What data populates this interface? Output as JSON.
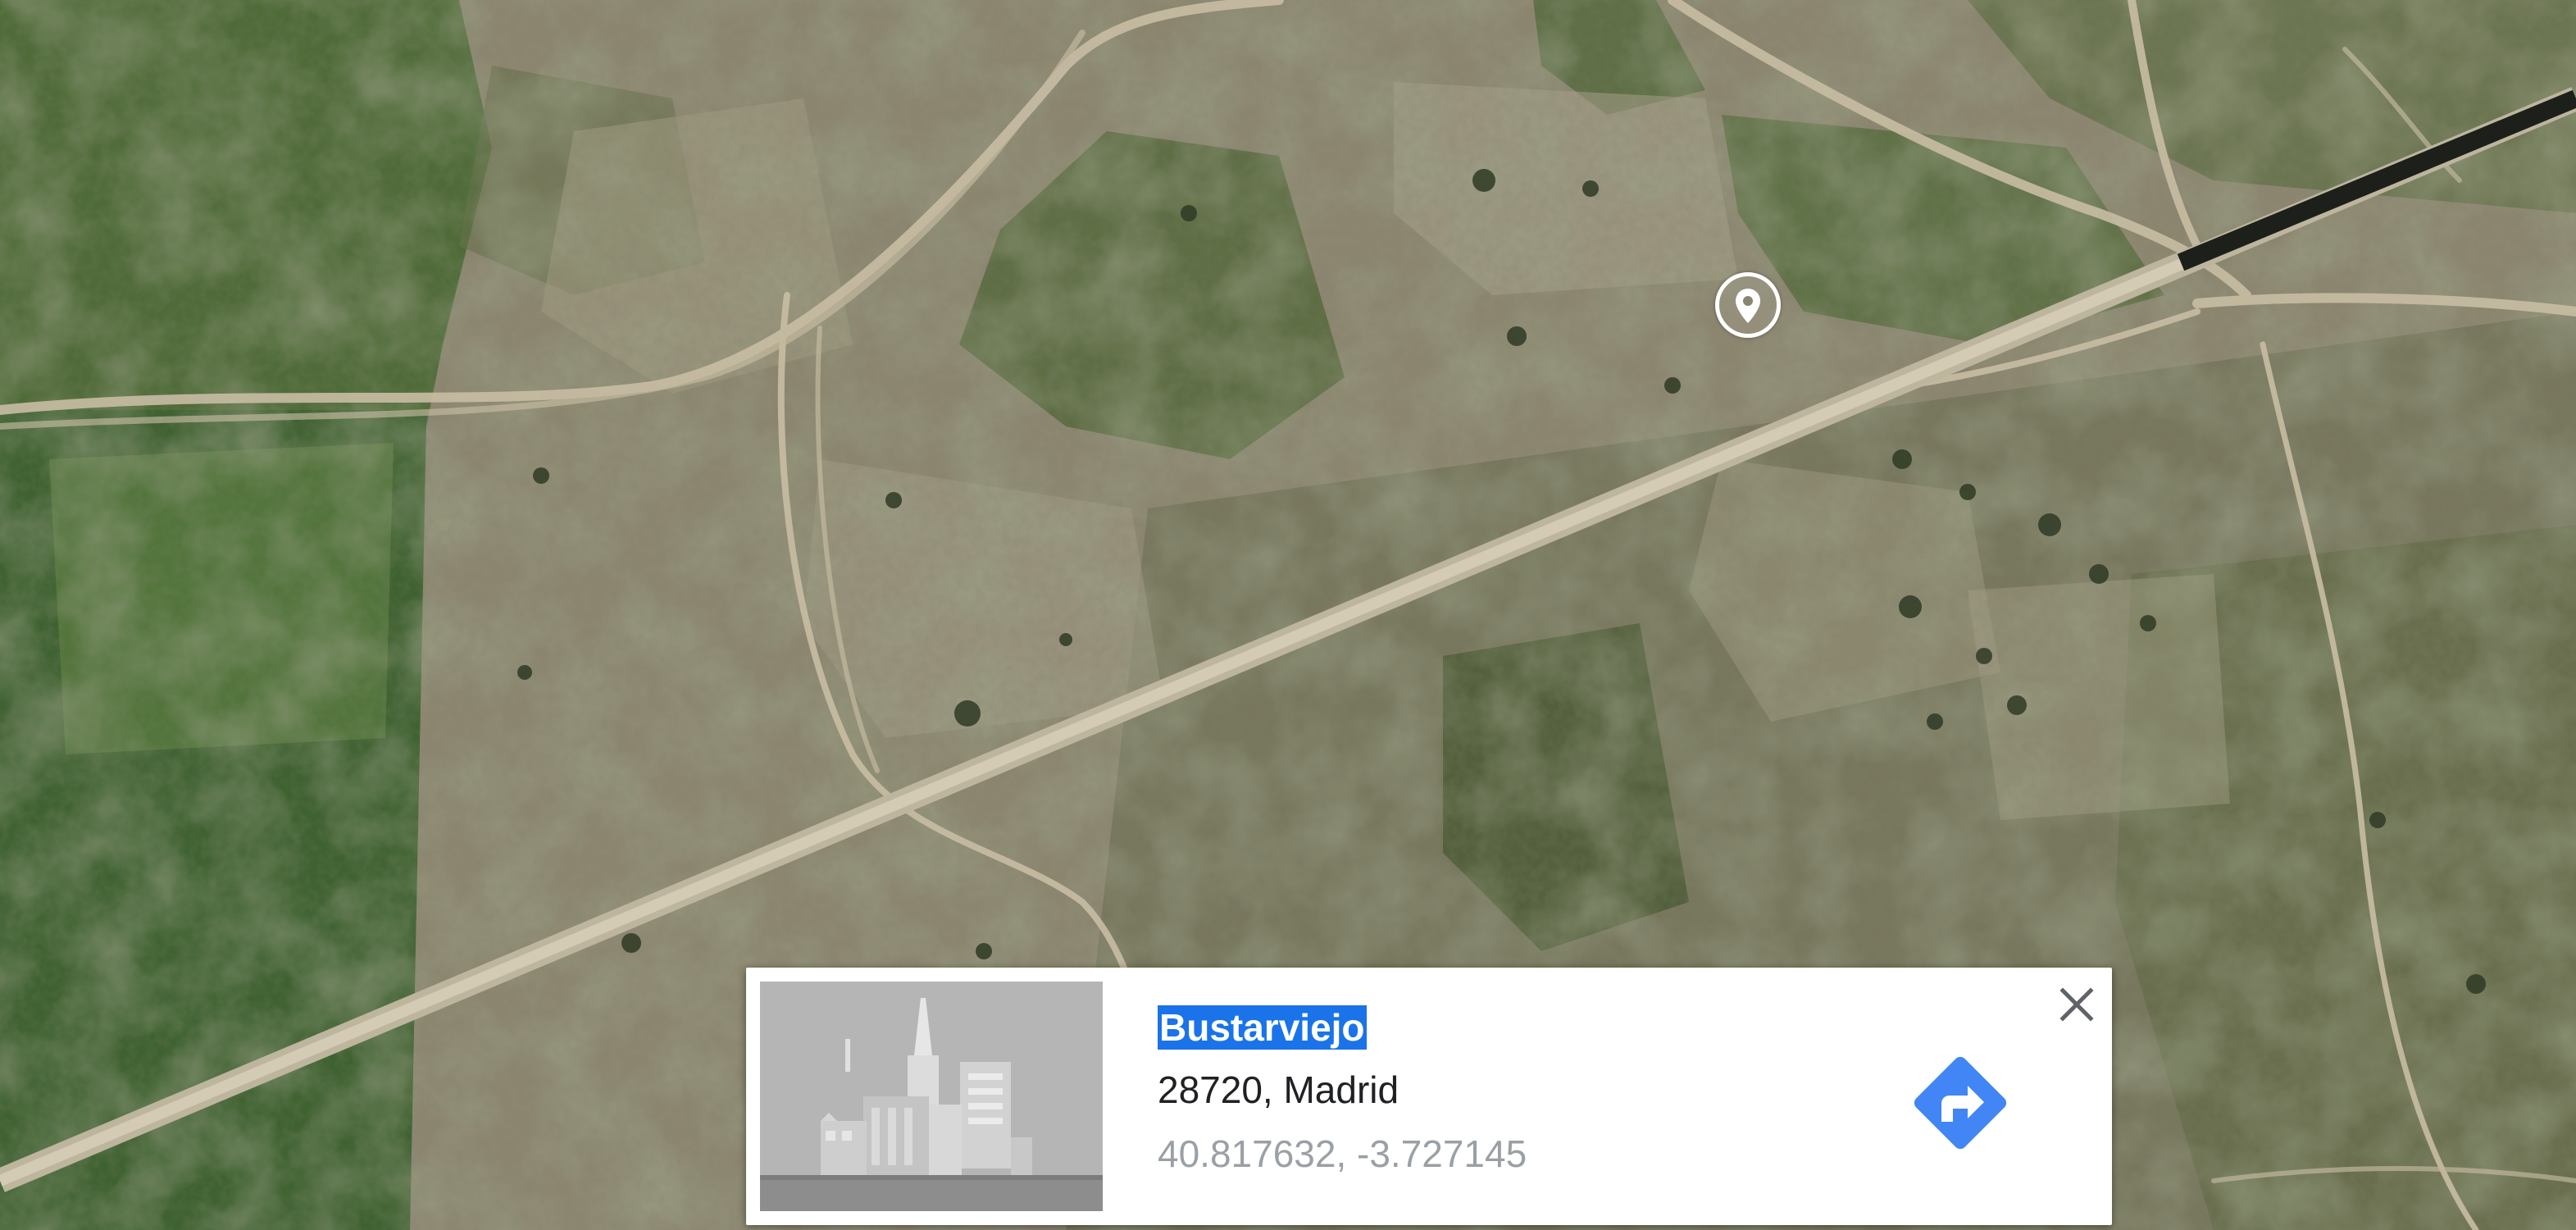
{
  "map": {
    "view": "satellite",
    "marker_icon": "location-pin-icon"
  },
  "place_card": {
    "name": "Bustarviejo",
    "address": "28720, Madrid",
    "coordinates": "40.817632, -3.727145",
    "thumbnail_icon": "city-placeholder-icon",
    "directions_icon": "directions-arrow-icon",
    "close_icon": "close-icon",
    "colors": {
      "name_highlight": "#1a73e8",
      "directions": "#4285f4",
      "coordinates_text": "#9aa0a6"
    }
  }
}
